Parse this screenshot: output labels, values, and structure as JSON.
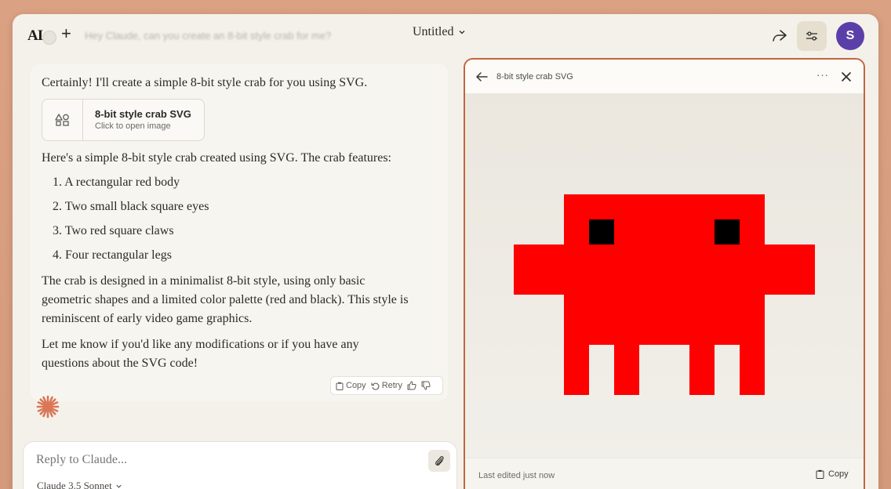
{
  "header": {
    "logo": "AI",
    "previous_prompt": "Hey Claude, can you create an 8-bit style crab for me?",
    "title": "Untitled"
  },
  "user": {
    "initial": "S"
  },
  "message": {
    "intro": "Certainly! I'll create a simple 8-bit style crab for you using SVG.",
    "artifact": {
      "title": "8-bit style crab SVG",
      "subtitle": "Click to open image"
    },
    "features_intro": "Here's a simple 8-bit style crab created using SVG. The crab features:",
    "features": [
      "1. A rectangular red body",
      "2. Two small black square eyes",
      "3. Two red square claws",
      "4. Four rectangular legs"
    ],
    "para1": "The crab is designed in a minimalist 8-bit style, using only basic geometric shapes and a limited color palette (red and black). This style is reminiscent of early video game graphics.",
    "para2": "Let me know if you'd like any modifications or if you have any questions about the SVG code!",
    "actions": {
      "copy": "Copy",
      "retry": "Retry"
    }
  },
  "reply": {
    "placeholder": "Reply to Claude...",
    "model": "Claude 3.5 Sonnet"
  },
  "panel": {
    "title": "8-bit style crab SVG",
    "footer_status": "Last edited just now",
    "copy": "Copy"
  },
  "colors": {
    "crab_red": "#ff0000",
    "crab_eye": "#000000",
    "accent_border": "#c0663f",
    "avatar": "#5b3fa8",
    "spark": "#d97757"
  }
}
